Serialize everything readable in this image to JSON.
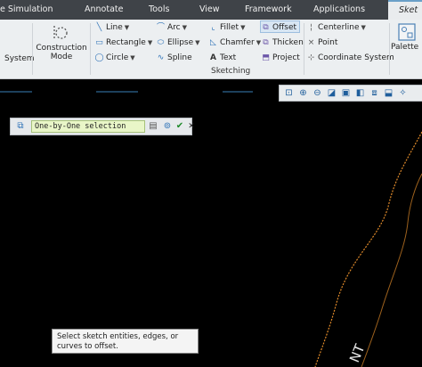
{
  "menubar": {
    "tabs": [
      {
        "label": "e Simulation",
        "active": false
      },
      {
        "label": "Annotate",
        "active": false
      },
      {
        "label": "Tools",
        "active": false
      },
      {
        "label": "View",
        "active": false
      },
      {
        "label": "Framework",
        "active": false
      },
      {
        "label": "Applications",
        "active": false
      },
      {
        "label": "Sket",
        "active": true
      }
    ]
  },
  "ribbon": {
    "system_label": "System",
    "construction_mode_line1": "Construction",
    "construction_mode_line2": "Mode",
    "line": "Line",
    "rectangle": "Rectangle",
    "circle": "Circle",
    "arc": "Arc",
    "ellipse": "Ellipse",
    "spline": "Spline",
    "fillet": "Fillet",
    "chamfer": "Chamfer",
    "text": "Text",
    "offset": "Offset",
    "thicken": "Thicken",
    "project": "Project",
    "centerline": "Centerline",
    "point": "Point",
    "coordinate_system": "Coordinate System",
    "palette": "Palette",
    "group_sketching": "Sketching"
  },
  "view_toolbar": {
    "icons": [
      "refit-icon",
      "zoom-in-icon",
      "zoom-out-icon",
      "repaint-icon",
      "named-views-icon",
      "display-style-icon",
      "view-manager-icon",
      "sketch-view-icon",
      "datum-display-icon"
    ]
  },
  "selection_bar": {
    "mode_value": "One-by-One selection"
  },
  "hint": {
    "text": "Select sketch entities, edges, or curves to offset."
  },
  "colors": {
    "menubar": "#3f4348",
    "ribbon": "#eceff1",
    "canvas": "#000000",
    "curve": "#e08a2a",
    "accent": "#4a90c4"
  }
}
